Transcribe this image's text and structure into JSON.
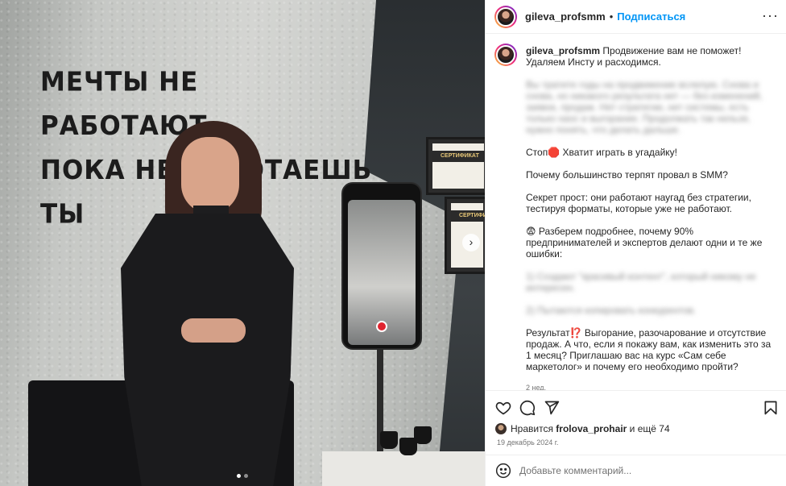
{
  "media": {
    "wall_text": [
      "МЕЧТЫ НЕ РАБОТАЮТ,",
      "ПОКА НЕ РАБОТАЕШЬ ТЫ"
    ],
    "cert_1_label": "СЕРТИФИКАТ",
    "cert_2_label": "СЕРТИФИКА",
    "next_icon": "chevron-right-icon",
    "slide_count": 2,
    "active_slide": 1
  },
  "header": {
    "username": "gileva_profsmm",
    "separator": "•",
    "follow_label": "Подписаться",
    "more_label": "···"
  },
  "caption": {
    "username": "gileva_profsmm",
    "headline": "Продвижение вам не поможет! Удаляем Инсту и расходимся.",
    "blurred_1": "Вы тратите годы на продвижение вслепую. Снова и снова, но никакого результата нет — без изменений, заявок, продаж. Нет стратегии, нет системы, есть только хаос и выгорание. Продолжать так нельзя, нужно понять, что делать дальше.",
    "stop_line": "Стоп🛑 Хватит играть в угадайку!",
    "question": "Почему большинство терпят провал в SMM?",
    "secret": "Секрет прост: они работают наугад без стратегии, тестируя форматы, которые уже не работают.",
    "analysis": "😨 Разберем подробнее, почему 90% предпринимателей и экспертов делают одни и те же ошибки:",
    "blurred_2": "1) Создают \"красивый контент\", который никому не интересен.",
    "blurred_3": "2) Пытаются копировать конкурентов.",
    "result": "Результат⁉️ Выгорание, разочарование и отсутствие продаж. А что, если я покажу вам, как изменить это за 1 месяц? Приглашаю вас на курс «Сам себе маркетолог» и почему его необходимо пройти?",
    "time": "2 нед."
  },
  "actions": {
    "like_icon": "heart-icon",
    "comment_icon": "comment-icon",
    "share_icon": "share-icon",
    "save_icon": "bookmark-icon"
  },
  "likes": {
    "prefix": "Нравится",
    "user": "frolova_prohair",
    "suffix": "и ещё 74"
  },
  "date": "19 декабрь 2024 г.",
  "comment": {
    "placeholder": "Добавьте комментарий...",
    "emoji_icon": "smile-icon"
  },
  "colors": {
    "accent": "#0095f6",
    "text": "#262626",
    "muted": "#737373",
    "border": "#efefef"
  }
}
